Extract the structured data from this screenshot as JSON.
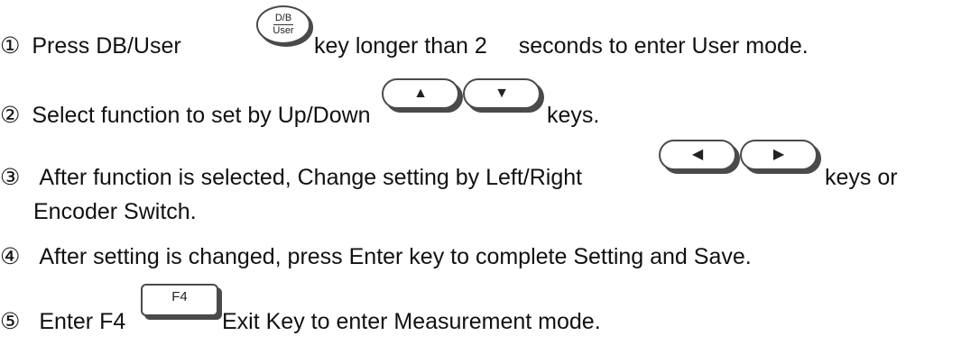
{
  "steps": [
    {
      "number": "①",
      "text_a": "Press DB/User",
      "key": {
        "top": "D/B",
        "bottom": "User"
      },
      "text_b": "key longer than 2",
      "text_c": "seconds to enter User mode."
    },
    {
      "number": "②",
      "text_a": "Select function to set by Up/Down",
      "keys": [
        "▲",
        "▼"
      ],
      "text_b": "keys."
    },
    {
      "number": "③",
      "text_a": "After function is selected, Change setting by Left/Right",
      "keys": [
        "◀",
        "▶"
      ],
      "text_b": "keys or",
      "text_cont": "Encoder Switch."
    },
    {
      "number": "④",
      "text_a": "After setting is changed, press Enter key to complete Setting and Save."
    },
    {
      "number": "⑤",
      "text_a": "Enter F4",
      "key": "F4",
      "text_b": "Exit Key to enter Measurement mode."
    }
  ],
  "icons": {
    "db_user_key": "db-user-key-icon",
    "up": "up-arrow-key-icon",
    "down": "down-arrow-key-icon",
    "left": "left-arrow-key-icon",
    "right": "right-arrow-key-icon",
    "f4": "f4-key-icon"
  }
}
